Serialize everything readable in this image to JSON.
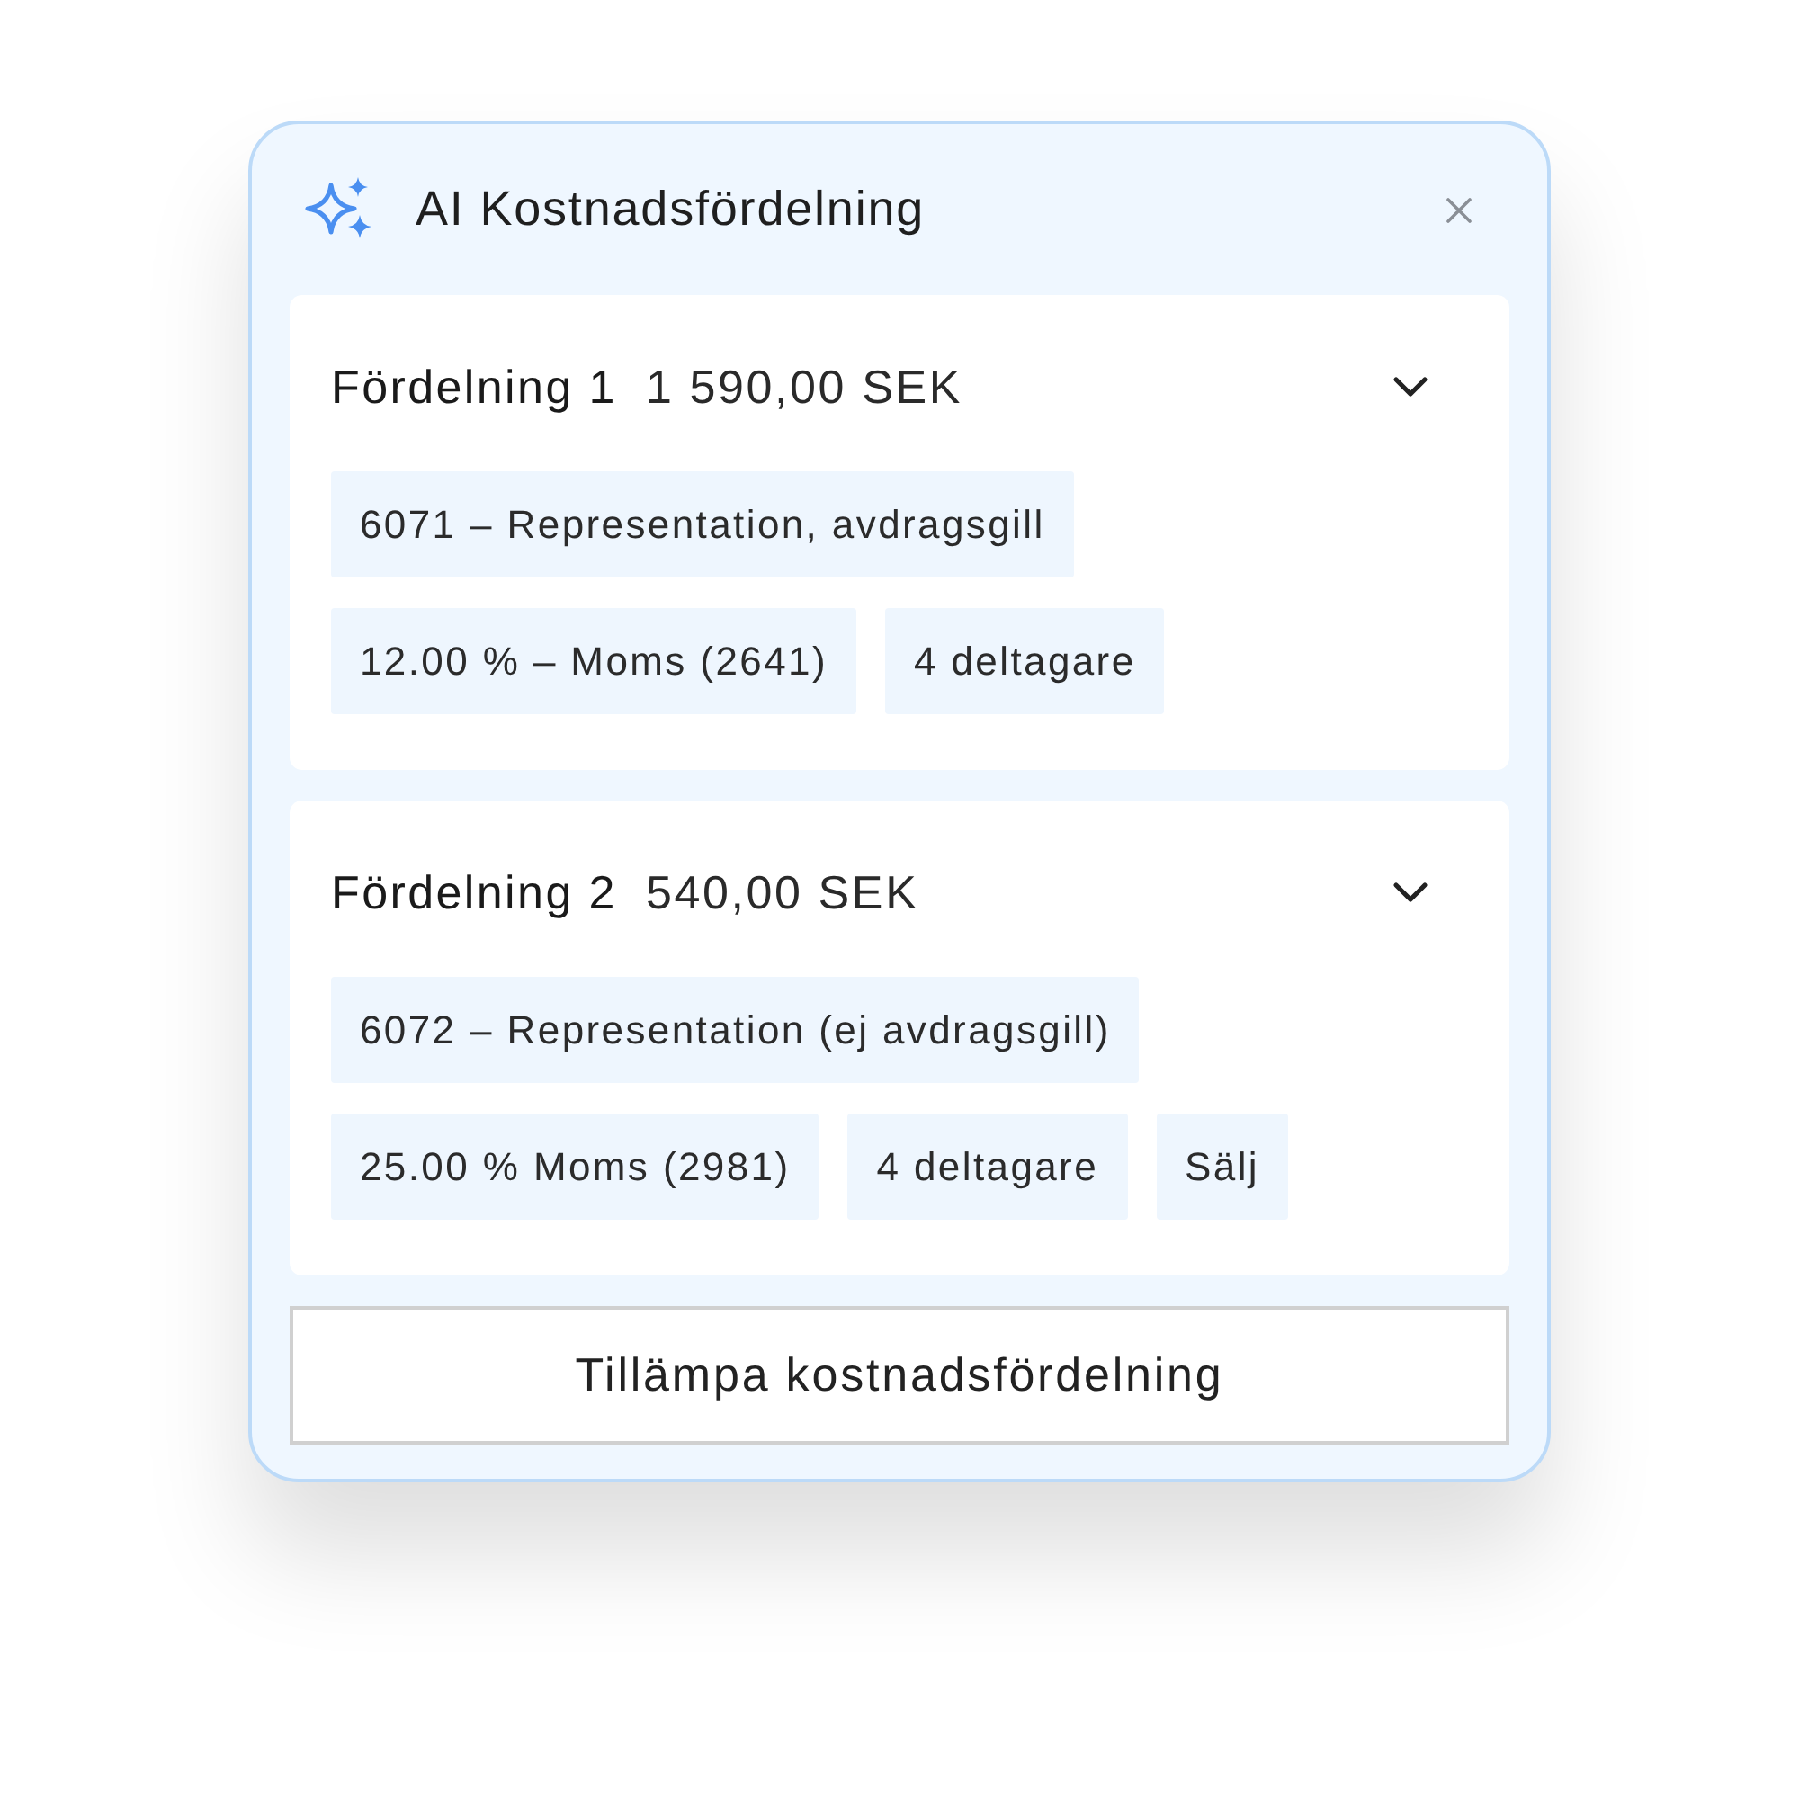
{
  "dialog": {
    "title": "AI Kostnadsfördelning"
  },
  "allocations": [
    {
      "name": "Fördelning 1",
      "amount": "1 590,00 SEK",
      "expanded": true,
      "account": "6071 – Representation, avdragsgill",
      "tags": [
        "12.00 % – Moms (2641)",
        "4 deltagare"
      ]
    },
    {
      "name": "Fördelning 2",
      "amount": "540,00 SEK",
      "expanded": true,
      "account": "6072 – Representation (ej avdragsgill)",
      "tags": [
        "25.00 % Moms (2981)",
        "4 deltagare",
        "Sälj"
      ]
    }
  ],
  "apply_button": "Tillämpa kostnadsfördelning"
}
